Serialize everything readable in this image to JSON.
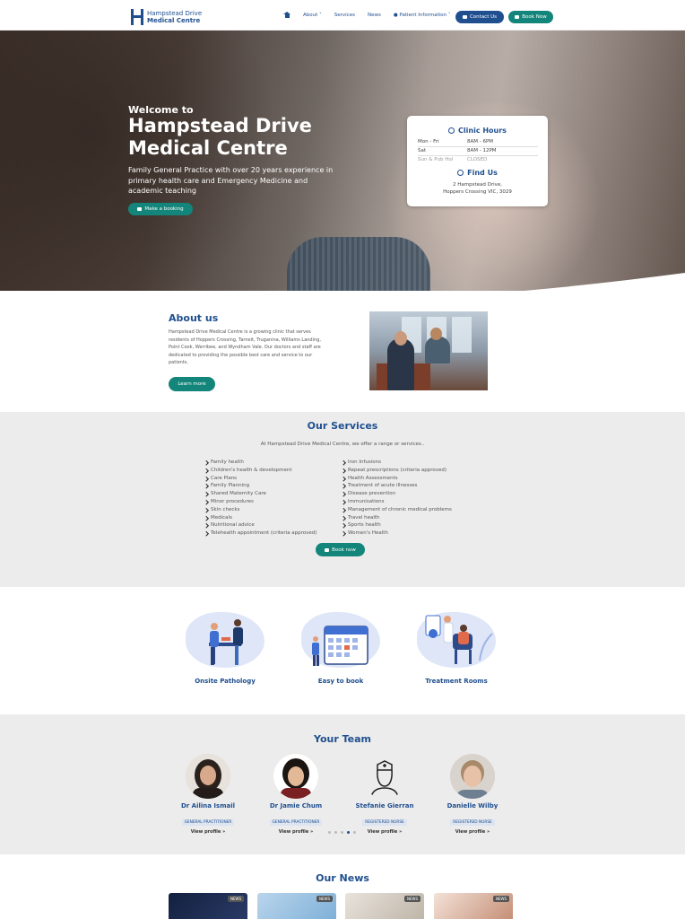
{
  "header": {
    "logo_line1": "Hampstead Drive",
    "logo_line2": "Medical Centre",
    "nav": [
      "About",
      "Services",
      "News",
      "Patient Information"
    ],
    "contact_button": "Contact Us",
    "book_button": "Book Now"
  },
  "hero": {
    "welcome": "Welcome to",
    "title": "Hampstead Drive Medical Centre",
    "subtitle": "Family General Practice with over 20 years experience in primary health care and Emergency Medicine and academic teaching",
    "booking_button": "Make a booking"
  },
  "clinic_card": {
    "hours_title": "Clinic Hours",
    "hours": [
      {
        "day": "Mon - Fri",
        "time": "8AM - 6PM"
      },
      {
        "day": "Sat",
        "time": "8AM - 12PM"
      },
      {
        "day": "Sun & Pub Hol",
        "time": "CLOSED"
      }
    ],
    "find_title": "Find Us",
    "address_line1": "2 Hampstead Drive,",
    "address_line2": "Hoppers Crossing VIC, 3029"
  },
  "about": {
    "title": "About us",
    "text": "Hampstead Drive Medical Centre is a growing clinic that serves residents of Hoppers Crossing, Tarneit, Truganina, Williams Landing, Point Cook, Werribee, and Wyndham Vale. Our doctors and staff are dedicated to providing the possible best care and service to our patients.",
    "button": "Learn more"
  },
  "services": {
    "title": "Our Services",
    "intro": "At Hampstead Drive Medical Centre, we offer a range or services..",
    "left": [
      "Family health",
      "Children's health & development",
      "Care Plans",
      "Family Planning",
      "Shared Maternity Care",
      "Minor procedures",
      "Skin checks",
      "Medicals",
      "Nutritional advice",
      "Telehealth appointment (criteria approved)"
    ],
    "right": [
      "Iron Infusions",
      "Repeat prescriptions (criteria approved)",
      "Health Assessments",
      "Treatment of acute illnesses",
      "Disease prevention",
      "Immunisations",
      "Management of chronic medical problems",
      "Travel health",
      "Sports health",
      "Women's Health"
    ],
    "button": "Book now"
  },
  "features": [
    {
      "label": "Onsite Pathology"
    },
    {
      "label": "Easy to book"
    },
    {
      "label": "Treatment Rooms"
    }
  ],
  "team": {
    "title": "Your Team",
    "members": [
      {
        "name": "Dr Ailina Ismail",
        "role": "GENERAL PRACTITIONER",
        "link": "View profile »"
      },
      {
        "name": "Dr Jamie Chum",
        "role": "GENERAL PRACTITIONER",
        "link": "View profile »"
      },
      {
        "name": "Stefanie Gierran",
        "role": "REGISTERED NURSE",
        "link": "View profile »"
      },
      {
        "name": "Danielle Wilby",
        "role": "REGISTERED NURSE",
        "link": "View profile »"
      }
    ]
  },
  "news": {
    "title": "Our News",
    "tag": "NEWS"
  },
  "colors": {
    "primary": "#1f4f8f",
    "accent": "#13857a",
    "section_bg": "#ececec"
  }
}
